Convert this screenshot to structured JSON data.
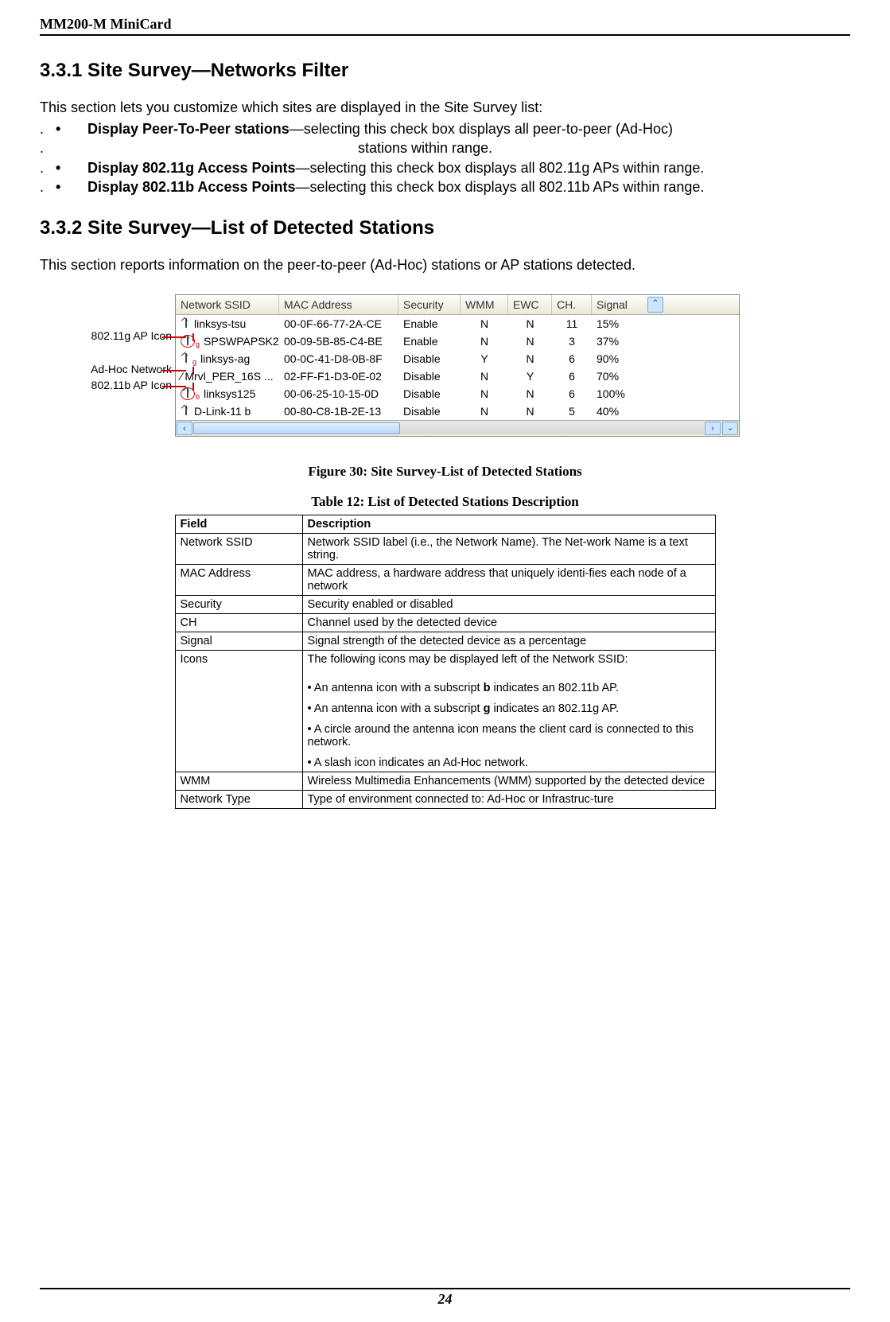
{
  "header": {
    "title": "MM200-M MiniCard"
  },
  "section331": {
    "heading": "3.3.1 Site Survey—Networks Filter",
    "intro": "This section lets you customize which sites are displayed in the Site Survey list:",
    "bullets": [
      {
        "label": "Display Peer-To-Peer stations",
        "text": "—selecting this check box displays all peer-to-peer (Ad-Hoc)"
      },
      {
        "cont": "stations within range."
      },
      {
        "label": "Display 802.11g Access Points",
        "text": "—selecting this check box displays all 802.11g APs within range."
      },
      {
        "label": "Display 802.11b Access Points",
        "text": "—selecting this check box displays all 802.11b APs within range."
      }
    ]
  },
  "section332": {
    "heading": "3.3.2 Site Survey—List of Detected Stations",
    "intro": "This section reports information on the peer-to-peer (Ad-Hoc) stations or AP stations detected."
  },
  "callouts": {
    "g": "802.11g AP Icon",
    "adhoc": "Ad-Hoc Network",
    "b": "802.11b AP Icon"
  },
  "list": {
    "headers": {
      "ssid": "Network SSID",
      "mac": "MAC Address",
      "sec": "Security",
      "wmm": "WMM",
      "ewc": "EWC",
      "ch": "CH.",
      "sig": "Signal"
    },
    "rows": [
      {
        "icon": "ant",
        "sub": "",
        "ssid": "linksys-tsu",
        "mac": "00-0F-66-77-2A-CE",
        "sec": "Enable",
        "wmm": "N",
        "ewc": "N",
        "ch": "11",
        "sig": "15%"
      },
      {
        "icon": "circ",
        "sub": "g",
        "ssid": "SPSWPAPSK2",
        "mac": "00-09-5B-85-C4-BE",
        "sec": "Enable",
        "wmm": "N",
        "ewc": "N",
        "ch": "3",
        "sig": "37%"
      },
      {
        "icon": "ant",
        "sub": "g",
        "ssid": "linksys-ag",
        "mac": "00-0C-41-D8-0B-8F",
        "sec": "Disable",
        "wmm": "Y",
        "ewc": "N",
        "ch": "6",
        "sig": "90%"
      },
      {
        "icon": "slash",
        "sub": "",
        "ssid": "Mrvl_PER_16S ...",
        "mac": "02-FF-F1-D3-0E-02",
        "sec": "Disable",
        "wmm": "N",
        "ewc": "Y",
        "ch": "6",
        "sig": "70%"
      },
      {
        "icon": "circ",
        "sub": "b",
        "ssid": "linksys125",
        "mac": "00-06-25-10-15-0D",
        "sec": "Disable",
        "wmm": "N",
        "ewc": "N",
        "ch": "6",
        "sig": "100%"
      },
      {
        "icon": "ant",
        "sub": "",
        "ssid": "D-Link-11 b",
        "mac": "00-80-C8-1B-2E-13",
        "sec": "Disable",
        "wmm": "N",
        "ewc": "N",
        "ch": "5",
        "sig": "40%"
      }
    ]
  },
  "captions": {
    "figure": "Figure 30: Site Survey-List of Detected Stations",
    "table": "Table 12: List of Detected Stations Description"
  },
  "table": {
    "headers": {
      "field": "Field",
      "desc": "Description"
    },
    "rows": [
      {
        "field": "Network SSID",
        "desc": "Network SSID label (i.e., the Network Name). The Net-work Name is a text string."
      },
      {
        "field": "MAC Address",
        "desc": "MAC address, a hardware address that uniquely identi-fies each node of a\nnetwork"
      },
      {
        "field": "Security",
        "desc": "Security enabled or disabled"
      },
      {
        "field": "CH",
        "desc": "Channel used by the detected device"
      },
      {
        "field": "Signal",
        "desc": "Signal strength of the detected device as a percentage"
      },
      {
        "field": "Icons",
        "desc_lines": [
          "The following icons may be displayed left of the Network SSID:",
          "",
          "• An antenna icon with a subscript b indicates an 802.11b AP.",
          "• An antenna icon with a subscript g indicates an 802.11g AP.",
          "• A circle around the antenna icon means the client card is connected to this network.",
          "• A slash icon indicates an Ad-Hoc network."
        ]
      },
      {
        "field": "WMM",
        "desc": "Wireless Multimedia Enhancements (WMM) supported by the detected device"
      },
      {
        "field": "Network Type",
        "desc": "Type of environment connected to: Ad-Hoc or Infrastruc-ture"
      }
    ]
  },
  "footer": {
    "page": "24"
  }
}
